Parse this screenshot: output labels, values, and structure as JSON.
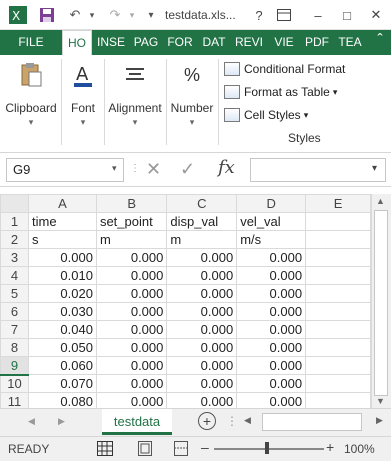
{
  "titlebar": {
    "doc_title": "testdata.xls...",
    "help": "?"
  },
  "ribbon_tabs": [
    "FILE",
    "HO",
    "INSE",
    "PAG",
    "FOR",
    "DAT",
    "REVI",
    "VIE",
    "PDF",
    "TEA"
  ],
  "ribbon": {
    "clipboard": "Clipboard",
    "font": "Font",
    "alignment": "Alignment",
    "number": "Number",
    "conditional_formatting": "Conditional Format",
    "format_as_table": "Format as Table",
    "cell_styles": "Cell Styles",
    "styles_group": "Styles"
  },
  "formula_bar": {
    "name_box": "G9",
    "fx": "fx",
    "value": ""
  },
  "grid": {
    "columns": [
      "A",
      "B",
      "C",
      "D",
      "E"
    ],
    "selected_row": "9",
    "rows": [
      {
        "num": "1",
        "cells": [
          "time",
          "set_point",
          "disp_val",
          "vel_val",
          ""
        ]
      },
      {
        "num": "2",
        "cells": [
          "s",
          "m",
          "m",
          "m/s",
          ""
        ]
      },
      {
        "num": "3",
        "cells": [
          "0.000",
          "0.000",
          "0.000",
          "0.000",
          ""
        ]
      },
      {
        "num": "4",
        "cells": [
          "0.010",
          "0.000",
          "0.000",
          "0.000",
          ""
        ]
      },
      {
        "num": "5",
        "cells": [
          "0.020",
          "0.000",
          "0.000",
          "0.000",
          ""
        ]
      },
      {
        "num": "6",
        "cells": [
          "0.030",
          "0.000",
          "0.000",
          "0.000",
          ""
        ]
      },
      {
        "num": "7",
        "cells": [
          "0.040",
          "0.000",
          "0.000",
          "0.000",
          ""
        ]
      },
      {
        "num": "8",
        "cells": [
          "0.050",
          "0.000",
          "0.000",
          "0.000",
          ""
        ]
      },
      {
        "num": "9",
        "cells": [
          "0.060",
          "0.000",
          "0.000",
          "0.000",
          ""
        ]
      },
      {
        "num": "10",
        "cells": [
          "0.070",
          "0.000",
          "0.000",
          "0.000",
          ""
        ]
      },
      {
        "num": "11",
        "cells": [
          "0.080",
          "0.000",
          "0.000",
          "0.000",
          ""
        ]
      }
    ]
  },
  "sheet_tabs": {
    "active": "testdata"
  },
  "statusbar": {
    "status": "READY",
    "zoom": "100%"
  },
  "colors": {
    "accent": "#217346"
  }
}
